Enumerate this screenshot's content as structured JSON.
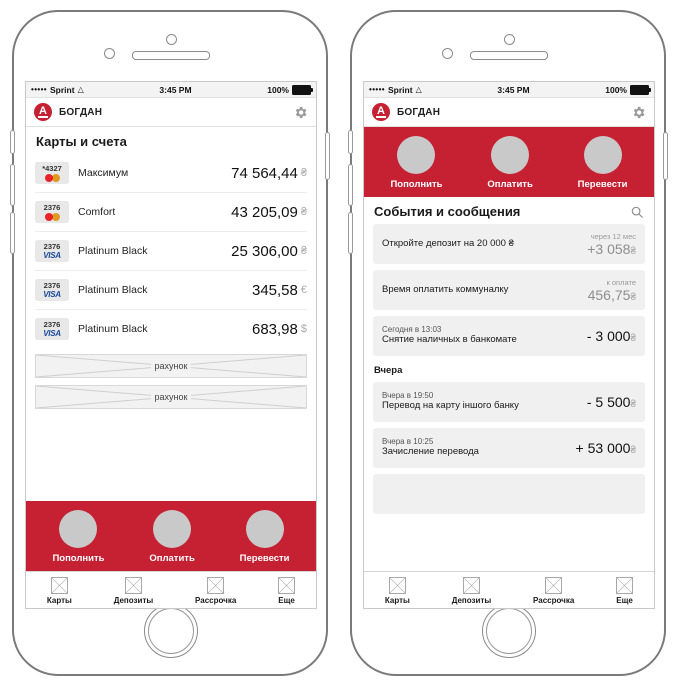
{
  "status_bar": {
    "signal_dots": "•••••",
    "carrier": "Sprint",
    "wifi_icon": "wifi-icon",
    "time": "3:45 PM",
    "battery_percent": "100%"
  },
  "nav": {
    "logo_letter": "A",
    "user_name": "БОГДАН",
    "settings_icon": "gear-icon"
  },
  "colors": {
    "brand_red": "#C62033",
    "visa_blue": "#1A4A9C",
    "mc_red": "#E8242A",
    "mc_orange": "#F7A823",
    "placeholder_gray": "#C9C9C9",
    "row_bg": "#f0f0f0"
  },
  "left_screen": {
    "title": "Карты и счета",
    "cards": [
      {
        "number": "*4327",
        "brand": "mastercard",
        "name": "Максимум",
        "amount": "74 564,44",
        "currency": "₴"
      },
      {
        "number": "2376",
        "brand": "mastercard",
        "name": "Comfort",
        "amount": "43 205,09",
        "currency": "₴"
      },
      {
        "number": "2376",
        "brand": "visa",
        "name": "Platinum Black",
        "amount": "25 306,00",
        "currency": "₴"
      },
      {
        "number": "2376",
        "brand": "visa",
        "name": "Platinum Black",
        "amount": "345,58",
        "currency": "€"
      },
      {
        "number": "2376",
        "brand": "visa",
        "name": "Platinum Black",
        "amount": "683,98",
        "currency": "$"
      }
    ],
    "placeholders": [
      {
        "label": "рахунок"
      },
      {
        "label": "рахунок"
      }
    ]
  },
  "actions": [
    {
      "label": "Пополнить",
      "icon": "circle-placeholder-icon"
    },
    {
      "label": "Оплатить",
      "icon": "circle-placeholder-icon"
    },
    {
      "label": "Перевести",
      "icon": "circle-placeholder-icon"
    }
  ],
  "right_screen": {
    "title": "События и сообщения",
    "search_icon": "search-icon",
    "events": [
      {
        "text": "Откройте депозит на 20 000 ₴",
        "caption": "через 12 мес",
        "value": "+3 058",
        "currency": "₴",
        "emphasis": "muted"
      },
      {
        "text": "Время оплатить коммуналку",
        "caption": "к оплате",
        "value": "456,75",
        "currency": "₴",
        "emphasis": "muted"
      },
      {
        "subtext": "Сегодня в 13:03",
        "text": "Снятие наличных в банкомате",
        "caption": "",
        "value": "- 3 000",
        "currency": "₴",
        "emphasis": "dark"
      }
    ],
    "day_label": "Вчера",
    "yesterday_events": [
      {
        "subtext": "Вчера в 19:50",
        "text": "Перевод на карту іншого банку",
        "value": "- 5 500",
        "currency": "₴",
        "emphasis": "dark"
      },
      {
        "subtext": "Вчера в 10:25",
        "text": "Зачисление перевода",
        "value": "+ 53 000",
        "currency": "₴",
        "emphasis": "dark"
      }
    ]
  },
  "tabs": [
    {
      "label": "Карты",
      "icon": "placeholder-box-icon"
    },
    {
      "label": "Депозиты",
      "icon": "placeholder-box-icon"
    },
    {
      "label": "Рассрочка",
      "icon": "placeholder-box-icon"
    },
    {
      "label": "Еще",
      "icon": "placeholder-box-icon"
    }
  ]
}
